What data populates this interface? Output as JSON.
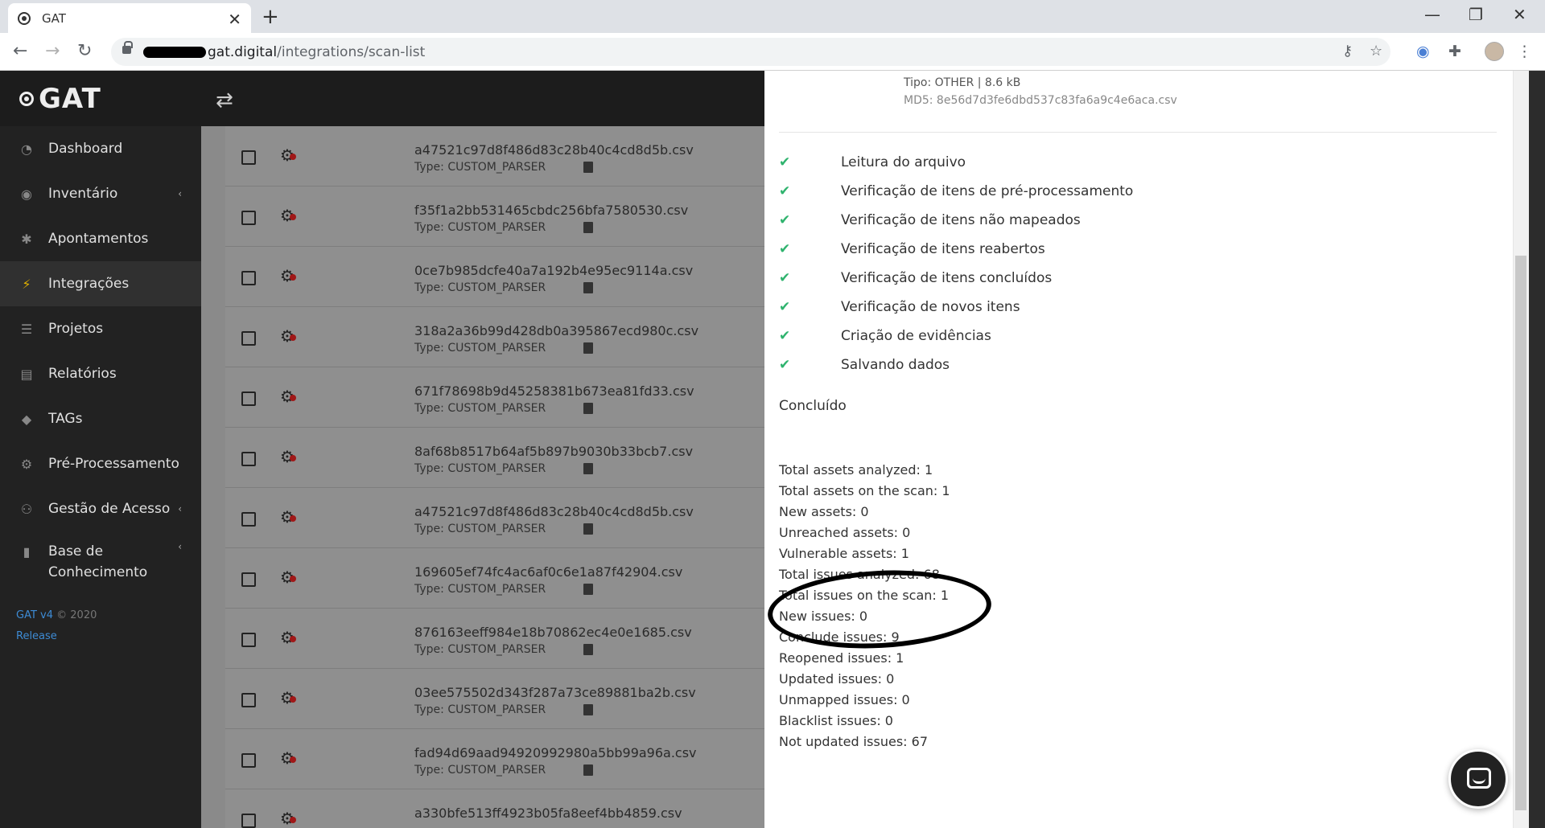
{
  "browser": {
    "tab_title": "GAT",
    "url_host": "gat.digital",
    "url_path": "/integrations/scan-list"
  },
  "app": {
    "logo": "GAT",
    "menu": [
      {
        "label": "Dashboard",
        "icon": "dashboard-icon",
        "arrow": false
      },
      {
        "label": "Inventário",
        "icon": "inventory-icon",
        "arrow": true
      },
      {
        "label": "Apontamentos",
        "icon": "bug-icon",
        "arrow": false
      },
      {
        "label": "Integrações",
        "icon": "plug-icon",
        "arrow": false,
        "active": true
      },
      {
        "label": "Projetos",
        "icon": "list-icon",
        "arrow": false
      },
      {
        "label": "Relatórios",
        "icon": "file-icon",
        "arrow": false
      },
      {
        "label": "TAGs",
        "icon": "tag-icon",
        "arrow": false
      },
      {
        "label": "Pré-Processamento",
        "icon": "gear-icon",
        "arrow": false
      },
      {
        "label": "Gestão de Acesso",
        "icon": "users-icon",
        "arrow": true
      },
      {
        "label": "Base de Conhecimento",
        "icon": "book-icon",
        "arrow": true
      }
    ],
    "footer_version": "GAT v4",
    "footer_copy": "© 2020",
    "footer_release": "Release"
  },
  "scan_list": [
    {
      "file": "a47521c97d8f486d83c28b40c4cd8d5b.csv",
      "type": "Type: CUSTOM_PARSER"
    },
    {
      "file": "f35f1a2bb531465cbdc256bfa7580530.csv",
      "type": "Type: CUSTOM_PARSER"
    },
    {
      "file": "0ce7b985dcfe40a7a192b4e95ec9114a.csv",
      "type": "Type: CUSTOM_PARSER"
    },
    {
      "file": "318a2a36b99d428db0a395867ecd980c.csv",
      "type": "Type: CUSTOM_PARSER"
    },
    {
      "file": "671f78698b9d45258381b673ea81fd33.csv",
      "type": "Type: CUSTOM_PARSER"
    },
    {
      "file": "8af68b8517b64af5b897b9030b33bcb7.csv",
      "type": "Type: CUSTOM_PARSER"
    },
    {
      "file": "a47521c97d8f486d83c28b40c4cd8d5b.csv",
      "type": "Type: CUSTOM_PARSER"
    },
    {
      "file": "169605ef74fc4ac6af0c6e1a87f42904.csv",
      "type": "Type: CUSTOM_PARSER"
    },
    {
      "file": "876163eeff984e18b70862ec4e0e1685.csv",
      "type": "Type: CUSTOM_PARSER"
    },
    {
      "file": "03ee575502d343f287a73ce89881ba2b.csv",
      "type": "Type: CUSTOM_PARSER"
    },
    {
      "file": "fad94d69aad94920992980a5bb99a96a.csv",
      "type": "Type: CUSTOM_PARSER"
    },
    {
      "file": "a330bfe513ff4923b05fa8eef4bb4859.csv",
      "type": ""
    }
  ],
  "detail": {
    "file_type": "Tipo: OTHER | 8.6 kB",
    "md5": "MD5: 8e56d7d3fe6dbd537c83fa6a9c4e6aca.csv",
    "steps": [
      "Leitura do arquivo",
      "Verificação de itens de pré-processamento",
      "Verificação de itens não mapeados",
      "Verificação de itens reabertos",
      "Verificação de itens concluídos",
      "Verificação de novos itens",
      "Criação de evidências",
      "Salvando dados"
    ],
    "status": "Concluído",
    "stats": [
      "Total assets analyzed: 1",
      "Total assets on the scan: 1",
      "New assets: 0",
      "Unreached assets: 0",
      "Vulnerable assets: 1",
      "Total issues analyzed: 68",
      "Total issues on the scan: 1",
      "New issues: 0",
      "Conclude issues: 9",
      "Reopened issues: 1",
      "Updated issues: 0",
      "Unmapped issues: 0",
      "Blacklist issues: 0",
      "Not updated issues: 67"
    ]
  }
}
